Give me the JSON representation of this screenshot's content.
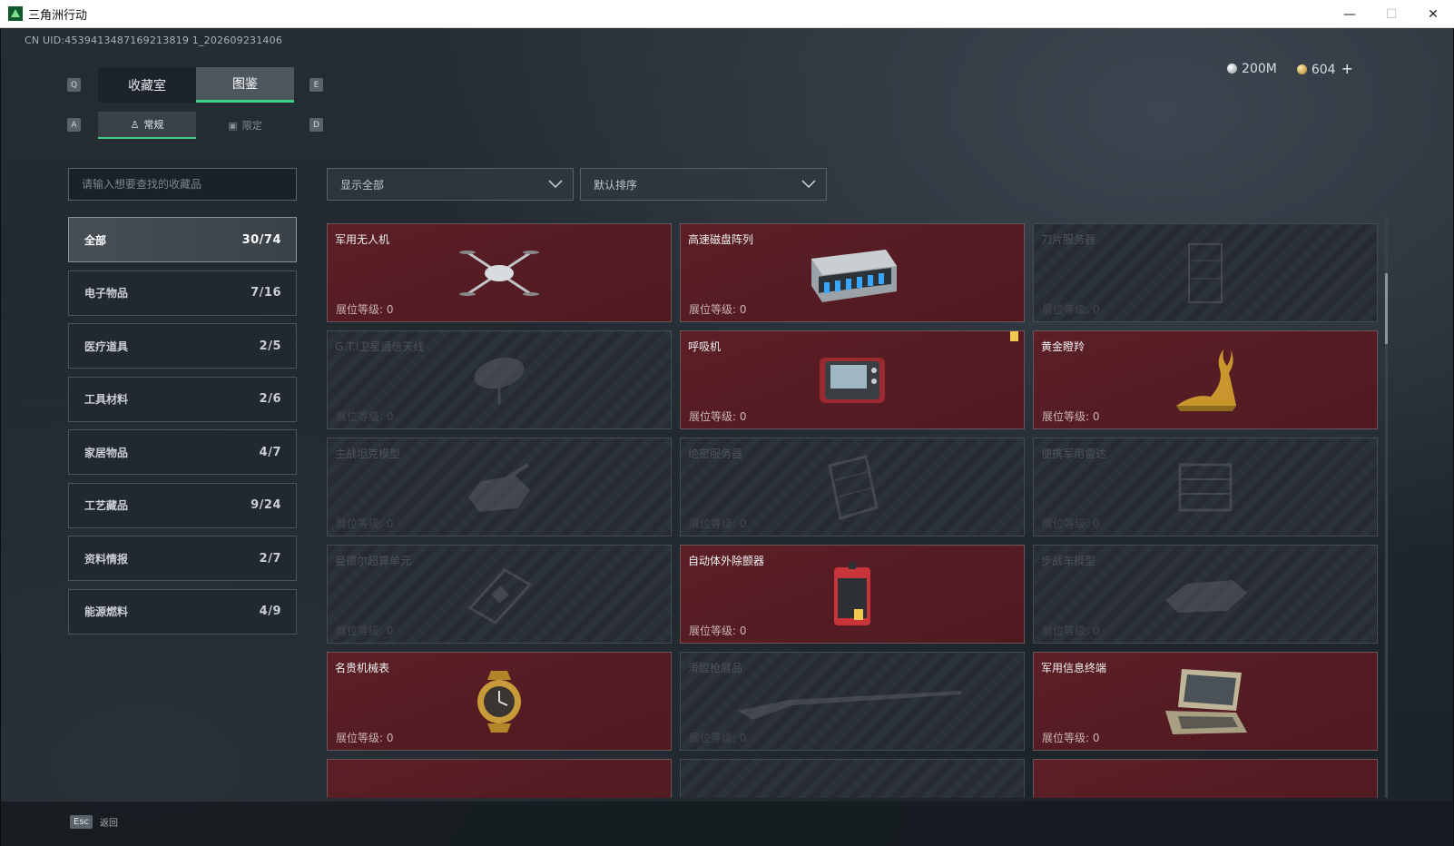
{
  "window": {
    "title": "三角洲行动",
    "minimize": "—",
    "maximize": "☐",
    "close": "✕"
  },
  "uid": "CN UID:4539413487169213819 1_202609231406",
  "currency": {
    "silver": "200M",
    "gold": "604",
    "plus": "+"
  },
  "tabs": {
    "key_left": "Q",
    "key_right": "E",
    "items": [
      "收藏室",
      "图鉴"
    ],
    "active": 1
  },
  "subtabs": {
    "key_left": "A",
    "key_right": "D",
    "items": [
      "常规",
      "限定"
    ]
  },
  "search": {
    "placeholder": "请输入想要查找的收藏品"
  },
  "filters": {
    "display": "显示全部",
    "sort": "默认排序"
  },
  "categories": [
    {
      "label": "全部",
      "count": "30/74"
    },
    {
      "label": "电子物品",
      "count": "7/16"
    },
    {
      "label": "医疗道具",
      "count": "2/5"
    },
    {
      "label": "工具材料",
      "count": "2/6"
    },
    {
      "label": "家居物品",
      "count": "4/7"
    },
    {
      "label": "工艺藏品",
      "count": "9/24"
    },
    {
      "label": "资料情报",
      "count": "2/7"
    },
    {
      "label": "能源燃料",
      "count": "4/9"
    }
  ],
  "level_label": "展位等级: 0",
  "items": [
    {
      "name": "军用无人机",
      "owned": true,
      "icon": "drone-icon"
    },
    {
      "name": "高速磁盘阵列",
      "owned": true,
      "icon": "disk-array-icon"
    },
    {
      "name": "刀片服务器",
      "owned": false,
      "icon": "blade-server-icon"
    },
    {
      "name": "G.T.I卫星通信天线",
      "owned": false,
      "icon": "satellite-dish-icon"
    },
    {
      "name": "呼吸机",
      "owned": true,
      "icon": "ventilator-icon"
    },
    {
      "name": "黄金瞪羚",
      "owned": true,
      "icon": "gold-gazelle-icon"
    },
    {
      "name": "主战坦克模型",
      "owned": false,
      "icon": "tank-model-icon"
    },
    {
      "name": "绝密服务器",
      "owned": false,
      "icon": "server-icon"
    },
    {
      "name": "便携军用雷达",
      "owned": false,
      "icon": "radar-icon"
    },
    {
      "name": "曼德尔超算单元",
      "owned": false,
      "icon": "supercomputer-icon"
    },
    {
      "name": "自动体外除颤器",
      "owned": true,
      "icon": "defibrillator-icon"
    },
    {
      "name": "步战车模型",
      "owned": false,
      "icon": "ifv-model-icon"
    },
    {
      "name": "名贵机械表",
      "owned": true,
      "icon": "watch-icon"
    },
    {
      "name": "滑膛枪展品",
      "owned": false,
      "icon": "musket-icon"
    },
    {
      "name": "军用信息终端",
      "owned": true,
      "icon": "terminal-icon"
    }
  ],
  "footer": {
    "esc_key": "Esc",
    "back_label": "返回"
  },
  "colors": {
    "accent": "#39d087",
    "owned_card": "#5c1f26",
    "locked_card": "#262c32"
  }
}
